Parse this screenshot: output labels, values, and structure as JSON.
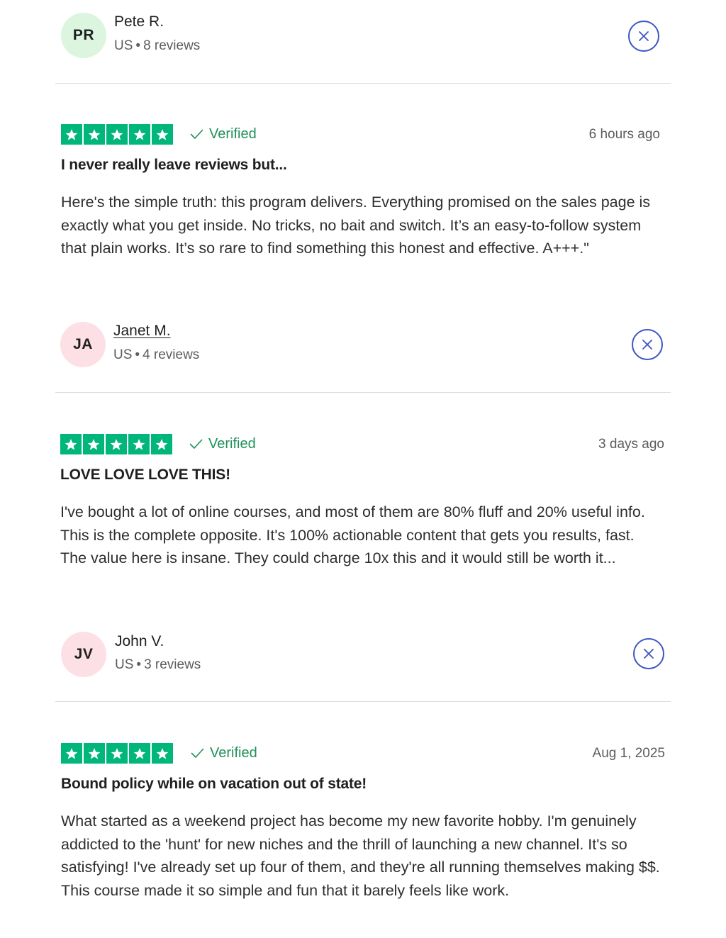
{
  "reviews": [
    {
      "reviewer": {
        "initials": "PR",
        "name": "Pete R.",
        "country": "US",
        "separator": "•",
        "review_count": "8 reviews",
        "avatar_color": "#dcf5df"
      },
      "rating": 5,
      "verified_label": "Verified",
      "date": "6 hours ago",
      "title": "I never really leave reviews but...",
      "text": "Here's the simple truth: this program delivers. Everything promised on the sales page is exactly what you get inside. No tricks, no bait and switch. It’s an easy-to-follow system that plain works. It’s so rare to find something this honest and effective. A+++.\""
    },
    {
      "reviewer": {
        "initials": "JA",
        "name": "Janet M.",
        "country": "US",
        "separator": "•",
        "review_count": "4 reviews",
        "avatar_color": "#fde0e6"
      },
      "rating": 5,
      "verified_label": "Verified",
      "date": "3 days ago",
      "title": "LOVE LOVE LOVE THIS!",
      "text": "I've bought a lot of online courses, and most of them are 80% fluff and 20% useful info. This is the complete opposite. It's 100% actionable content that gets you results, fast. The value here is insane. They could charge 10x this and it would still be worth it..."
    },
    {
      "reviewer": {
        "initials": "JV",
        "name": "John V.",
        "country": "US",
        "separator": "•",
        "review_count": "3 reviews",
        "avatar_color": "#fde0e6"
      },
      "rating": 5,
      "verified_label": "Verified",
      "date": "Aug 1, 2025",
      "title": "Bound policy while on vacation out of state!",
      "text": "What started as a weekend project has become my new favorite hobby. I'm genuinely addicted to the 'hunt' for new niches and the thrill of launching a new channel. It's so satisfying! I've already set up four of them, and they're all running themselves making $$. This course made it so simple and fun that it barely feels like work."
    }
  ],
  "colors": {
    "star_green": "#00b67a",
    "verified_green": "#1f9159",
    "close_blue": "#3d55c4"
  },
  "icons": {
    "star": "star-icon",
    "check": "check-icon",
    "close": "close-icon"
  }
}
